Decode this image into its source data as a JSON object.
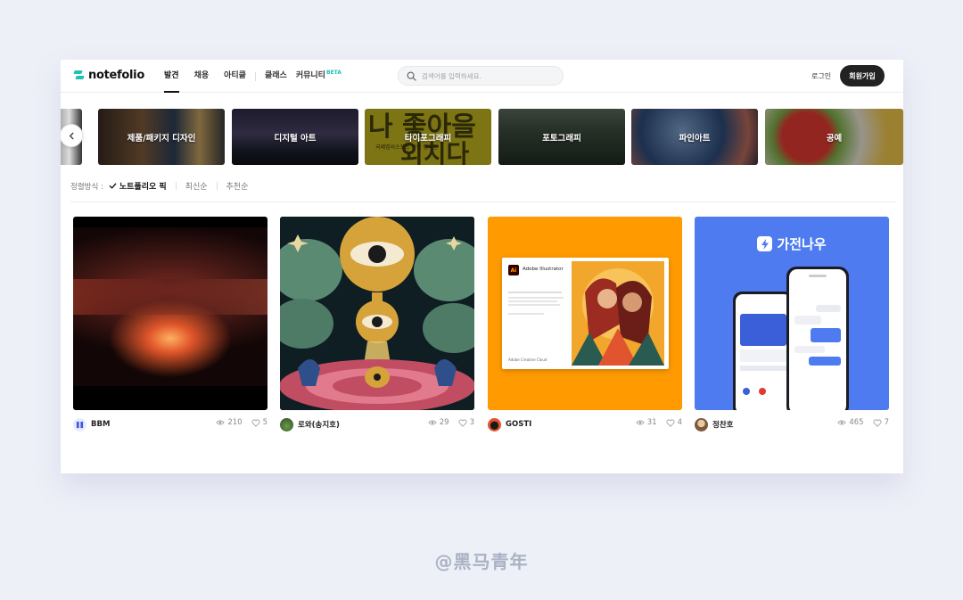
{
  "header": {
    "logo": "notefolio",
    "nav": [
      {
        "label": "발견",
        "active": true
      },
      {
        "label": "채용",
        "active": false
      },
      {
        "label": "아티클",
        "active": false
      },
      {
        "label": "클래스",
        "active": false
      },
      {
        "label": "커뮤니티",
        "active": false,
        "badge": "BETA"
      }
    ],
    "search_placeholder": "검색어를 입력하세요.",
    "login_label": "로그인",
    "signup_label": "회원가입"
  },
  "categories": [
    {
      "label": "제품/패키지 디자인"
    },
    {
      "label": "디지털 아트"
    },
    {
      "label": "타이포그래피"
    },
    {
      "label": "포토그래피"
    },
    {
      "label": "파인아트"
    },
    {
      "label": "공예"
    }
  ],
  "sort": {
    "label": "정렬방식 :",
    "options": [
      {
        "label": "노트폴리오 픽",
        "selected": true
      },
      {
        "label": "최신순",
        "selected": false
      },
      {
        "label": "추천순",
        "selected": false
      }
    ]
  },
  "cards": [
    {
      "author": "BBM",
      "views": "210",
      "likes": "5"
    },
    {
      "author": "로와(송지호)",
      "views": "29",
      "likes": "3"
    },
    {
      "author": "GOSTI",
      "views": "31",
      "likes": "4"
    },
    {
      "author": "정찬호",
      "views": "465",
      "likes": "7"
    }
  ],
  "card_art": {
    "typo_overlay_text": "국제엽서스포트 종합 캠페인",
    "illustrator_title": "Adobe Illustrator",
    "illustrator_footer": "Adobe Creative Cloud",
    "app_brand": "가전나우"
  },
  "colors": {
    "accent": "#1bc3b4",
    "dark_button": "#222222",
    "background": "#eef0f8"
  },
  "watermark": "@黑马青年"
}
